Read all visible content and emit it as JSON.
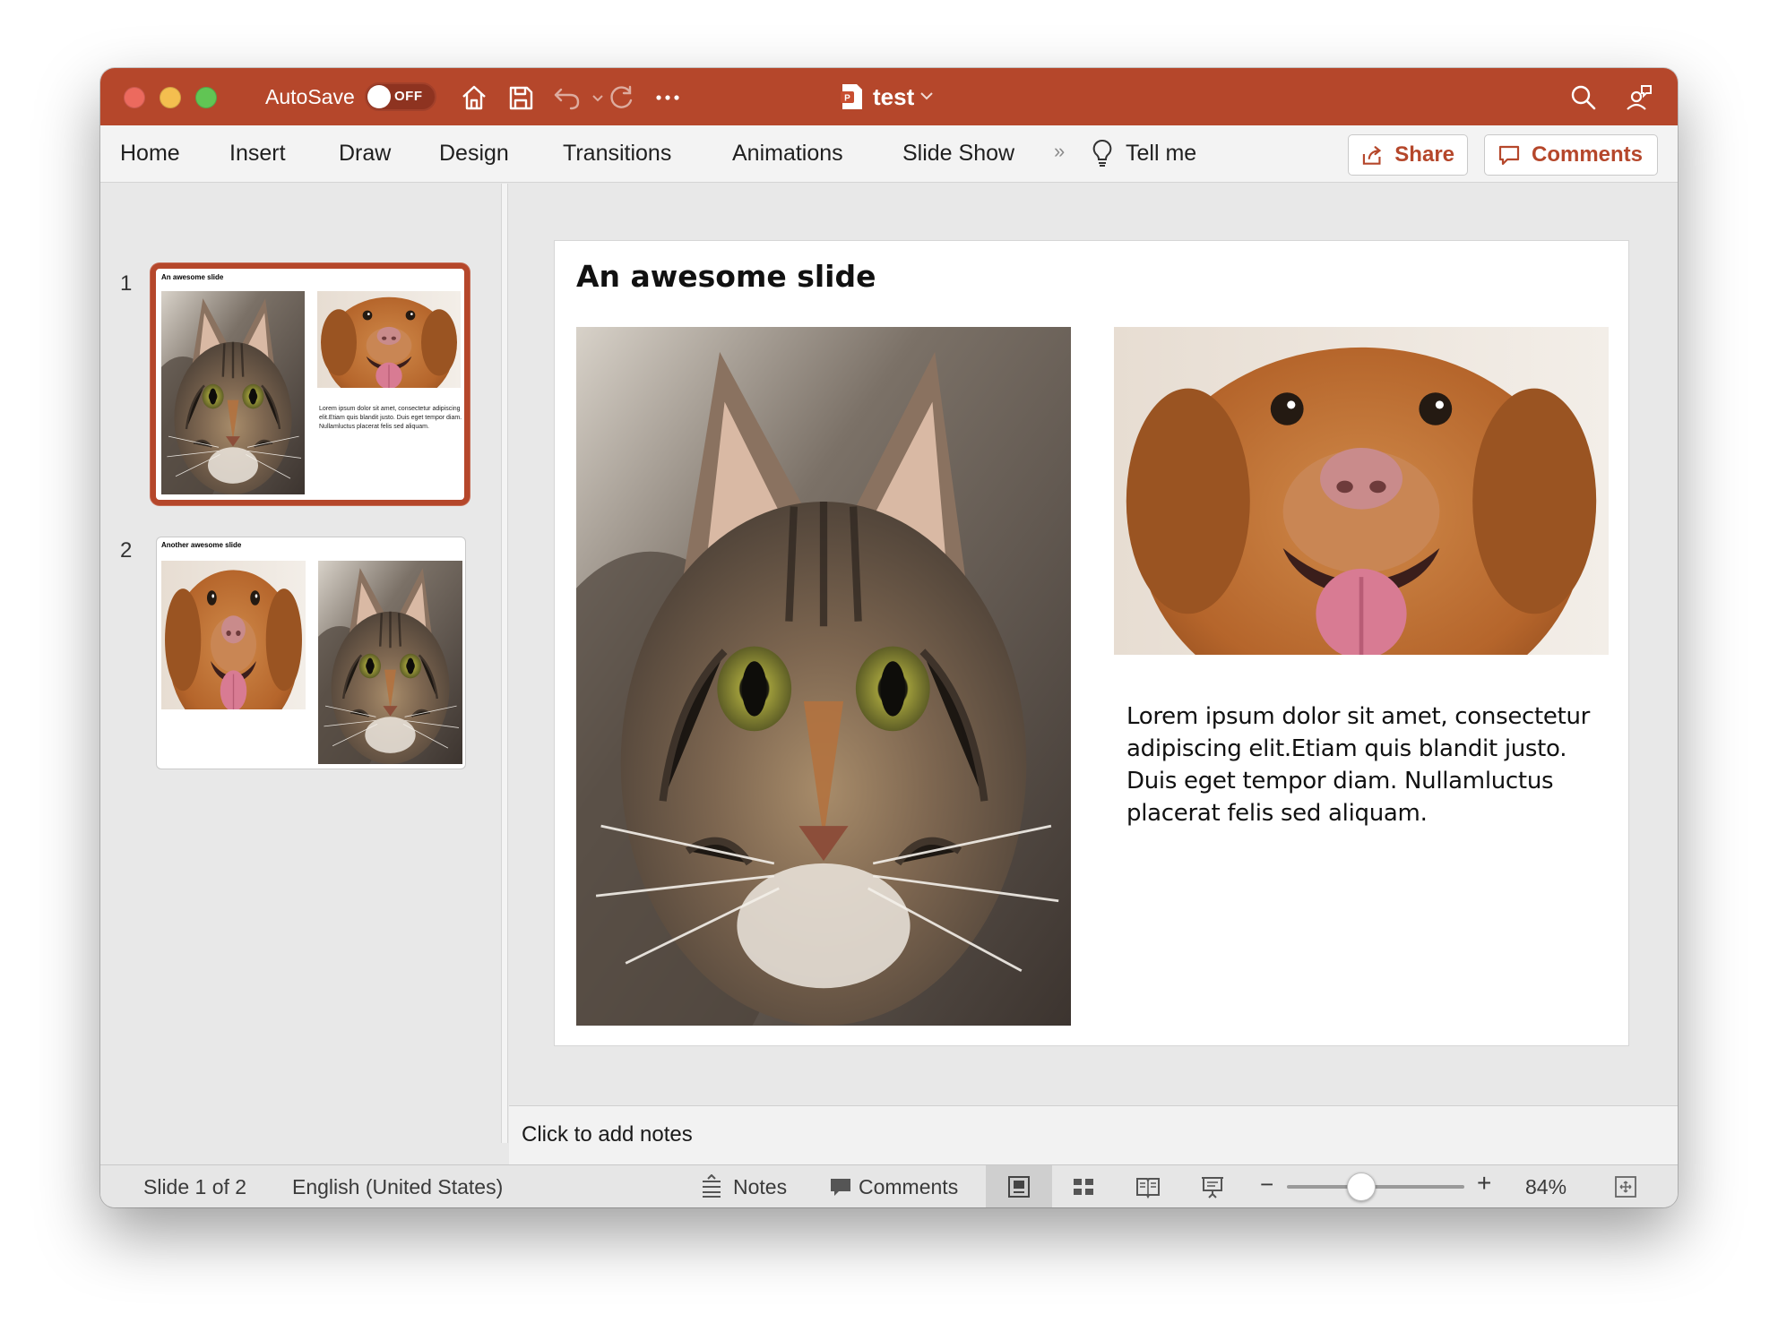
{
  "titlebar": {
    "autosave_label": "AutoSave",
    "autosave_state": "OFF",
    "document_title": "test",
    "accent_color": "#b5472b"
  },
  "ribbon": {
    "tabs": [
      {
        "label": "Home"
      },
      {
        "label": "Insert"
      },
      {
        "label": "Draw"
      },
      {
        "label": "Design"
      },
      {
        "label": "Transitions"
      },
      {
        "label": "Animations"
      },
      {
        "label": "Slide Show"
      }
    ],
    "overflow_label": "»",
    "tell_me_label": "Tell me",
    "share_label": "Share",
    "comments_label": "Comments"
  },
  "thumbnails": [
    {
      "number": "1",
      "title": "An awesome slide",
      "text": "Lorem ipsum dolor sit amet, consectetur adipiscing elit.Etiam quis blandit justo. Duis eget tempor diam. Nullamluctus placerat felis sed aliquam.",
      "selected": true
    },
    {
      "number": "2",
      "title": "Another awesome slide",
      "selected": false
    }
  ],
  "slide": {
    "title": "An awesome slide",
    "body": "Lorem ipsum dolor sit amet, consectetur adipiscing elit.Etiam quis blandit justo. Duis eget tempor diam. Nullamluctus placerat felis sed aliquam.",
    "images": [
      "cat-photo",
      "dog-photo"
    ]
  },
  "notes": {
    "placeholder": "Click to add notes"
  },
  "statusbar": {
    "slide_position": "Slide 1 of 2",
    "language": "English (United States)",
    "notes_label": "Notes",
    "comments_label": "Comments",
    "zoom_minus": "−",
    "zoom_plus": "+",
    "zoom_level": "84%",
    "zoom_fraction": 0.42
  }
}
